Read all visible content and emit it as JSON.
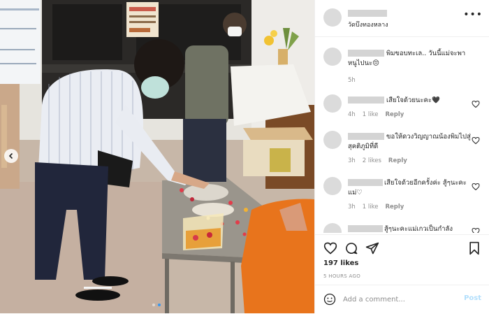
{
  "post": {
    "location": "วัดบึงทองหลาง",
    "more_label": "•••",
    "photo_alt": ""
  },
  "comments": [
    {
      "text": "พิมขอบทะเล.. วันนี้แม่จะพาหนูไปนะ😔",
      "time": "5h",
      "likes": "",
      "reply": ""
    },
    {
      "text": "เสียใจด้วยนะคะ🖤",
      "time": "4h",
      "likes": "1 like",
      "reply": "Reply"
    },
    {
      "text": "ขอให้ดวงวิญญาณน้องพิมไปสู่สุคติภูมิที่ดี",
      "time": "3h",
      "likes": "2 likes",
      "reply": "Reply"
    },
    {
      "text": "เสียใจด้วยอีกครั้งค่ะ สู้ๆนะคะแม่♡",
      "time": "3h",
      "likes": "1 like",
      "reply": "Reply"
    },
    {
      "text": "สู้ๆนะคะแม่เกวเป็นกำลัง",
      "time": "",
      "likes": "",
      "reply": ""
    }
  ],
  "stats": {
    "likes": "197 likes",
    "time": "5 HOURS AGO"
  },
  "composer": {
    "placeholder": "Add a comment...",
    "post_label": "Post"
  },
  "icons": {
    "like": "heart-icon",
    "comment": "comment-icon",
    "share": "share-icon",
    "save": "bookmark-icon",
    "emoji": "emoji-icon",
    "prev": "chevron-left-icon"
  },
  "colors": {
    "accent": "#3897f0",
    "post_disabled": "#b2dffc",
    "muted": "#8e8e8e",
    "monk_robe": "#e8741c"
  }
}
